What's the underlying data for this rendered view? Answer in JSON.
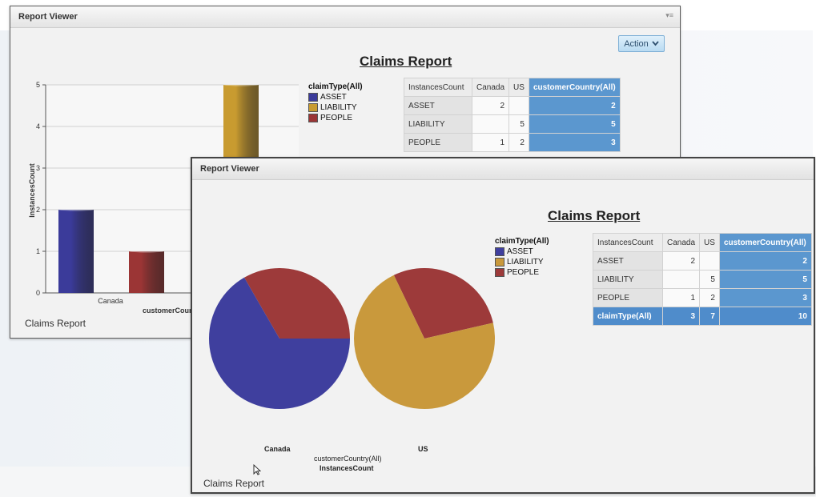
{
  "back_window": {
    "title": "Report Viewer",
    "report_title": "Claims Report",
    "action_label": "Action",
    "footer": "Claims Report",
    "chart_data": {
      "type": "bar",
      "ylabel": "InstancesCount",
      "xlabel": "customerCountry",
      "ylim": [
        0,
        5
      ],
      "yticks": [
        "0",
        "1",
        "2",
        "3",
        "4",
        "5"
      ],
      "categories": [
        "Canada"
      ],
      "series": [
        {
          "name": "ASSET",
          "color": "#3b3b9a",
          "values": [
            2
          ]
        },
        {
          "name": "PEOPLE",
          "color": "#9b3535",
          "values": [
            1
          ]
        },
        {
          "name": "LIABILITY",
          "color": "#c89b30",
          "values": [
            5
          ]
        }
      ],
      "legend_title": "claimType(All)",
      "legend": [
        "ASSET",
        "LIABILITY",
        "PEOPLE"
      ]
    },
    "table": {
      "headers": [
        "InstancesCount",
        "Canada",
        "US",
        "customerCountry(All)"
      ],
      "rows": [
        [
          "ASSET",
          "2",
          "",
          "2"
        ],
        [
          "LIABILITY",
          "",
          "5",
          "5"
        ],
        [
          "PEOPLE",
          "1",
          "2",
          "3"
        ]
      ]
    }
  },
  "front_window": {
    "title": "Report Viewer",
    "report_title": "Claims Report",
    "footer": "Claims Report",
    "legend_title": "claimType(All)",
    "legend": [
      {
        "label": "ASSET",
        "color": "#3f3f9e"
      },
      {
        "label": "LIABILITY",
        "color": "#c9993c"
      },
      {
        "label": "PEOPLE",
        "color": "#9d3a3a"
      }
    ],
    "chart_data": [
      {
        "type": "pie",
        "category": "Canada",
        "labels": [
          "ASSET",
          "PEOPLE"
        ],
        "values": [
          2,
          1
        ]
      },
      {
        "type": "pie",
        "category": "US",
        "labels": [
          "LIABILITY",
          "PEOPLE"
        ],
        "values": [
          5,
          2
        ]
      }
    ],
    "x_title": "customerCountry(All)",
    "measure_title": "InstancesCount",
    "table": {
      "headers": [
        "InstancesCount",
        "Canada",
        "US",
        "customerCountry(All)"
      ],
      "rows": [
        [
          "ASSET",
          "2",
          "",
          "2"
        ],
        [
          "LIABILITY",
          "",
          "5",
          "5"
        ],
        [
          "PEOPLE",
          "1",
          "2",
          "3"
        ]
      ],
      "total": [
        "claimType(All)",
        "3",
        "7",
        "10"
      ]
    }
  }
}
